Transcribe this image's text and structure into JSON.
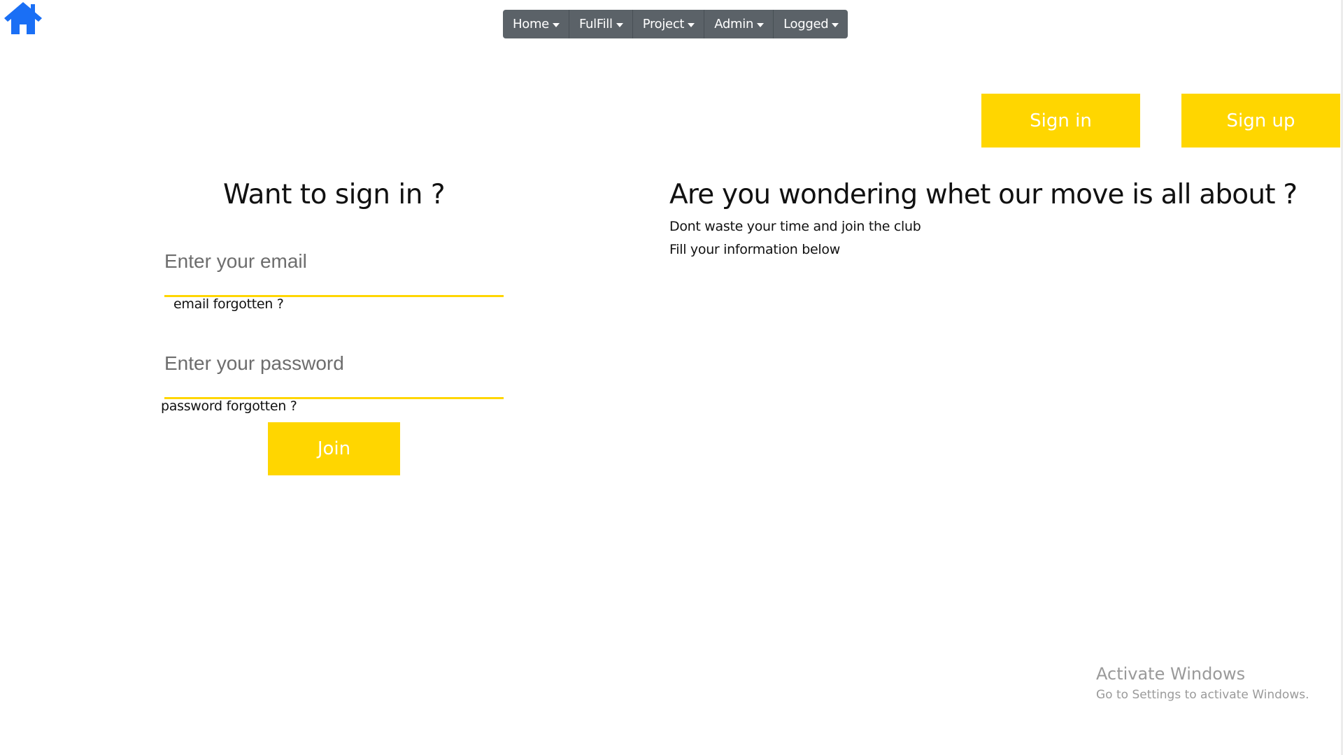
{
  "colors": {
    "accent": "#ffd600",
    "nav_bg": "#5b6268",
    "home_icon": "#1a6ff5"
  },
  "header": {
    "home_icon": "home-icon",
    "nav": [
      {
        "label": "Home"
      },
      {
        "label": "FulFill"
      },
      {
        "label": "Project"
      },
      {
        "label": "Admin"
      },
      {
        "label": "Logged"
      }
    ]
  },
  "auth": {
    "signin_label": "Sign in",
    "signup_label": "Sign up"
  },
  "signin_form": {
    "title": "Want to sign in ?",
    "email_placeholder": "Enter your email",
    "email_forgot": "email forgotten ?",
    "password_placeholder": "Enter your password",
    "password_forgot": "password forgotten ?",
    "join_label": "Join"
  },
  "info": {
    "title": "Are you wondering whet our move is all about ?",
    "line1": "Dont waste your time and join the club",
    "line2": "Fill your information below"
  },
  "watermark": {
    "title": "Activate Windows",
    "subtitle": "Go to Settings to activate Windows."
  }
}
